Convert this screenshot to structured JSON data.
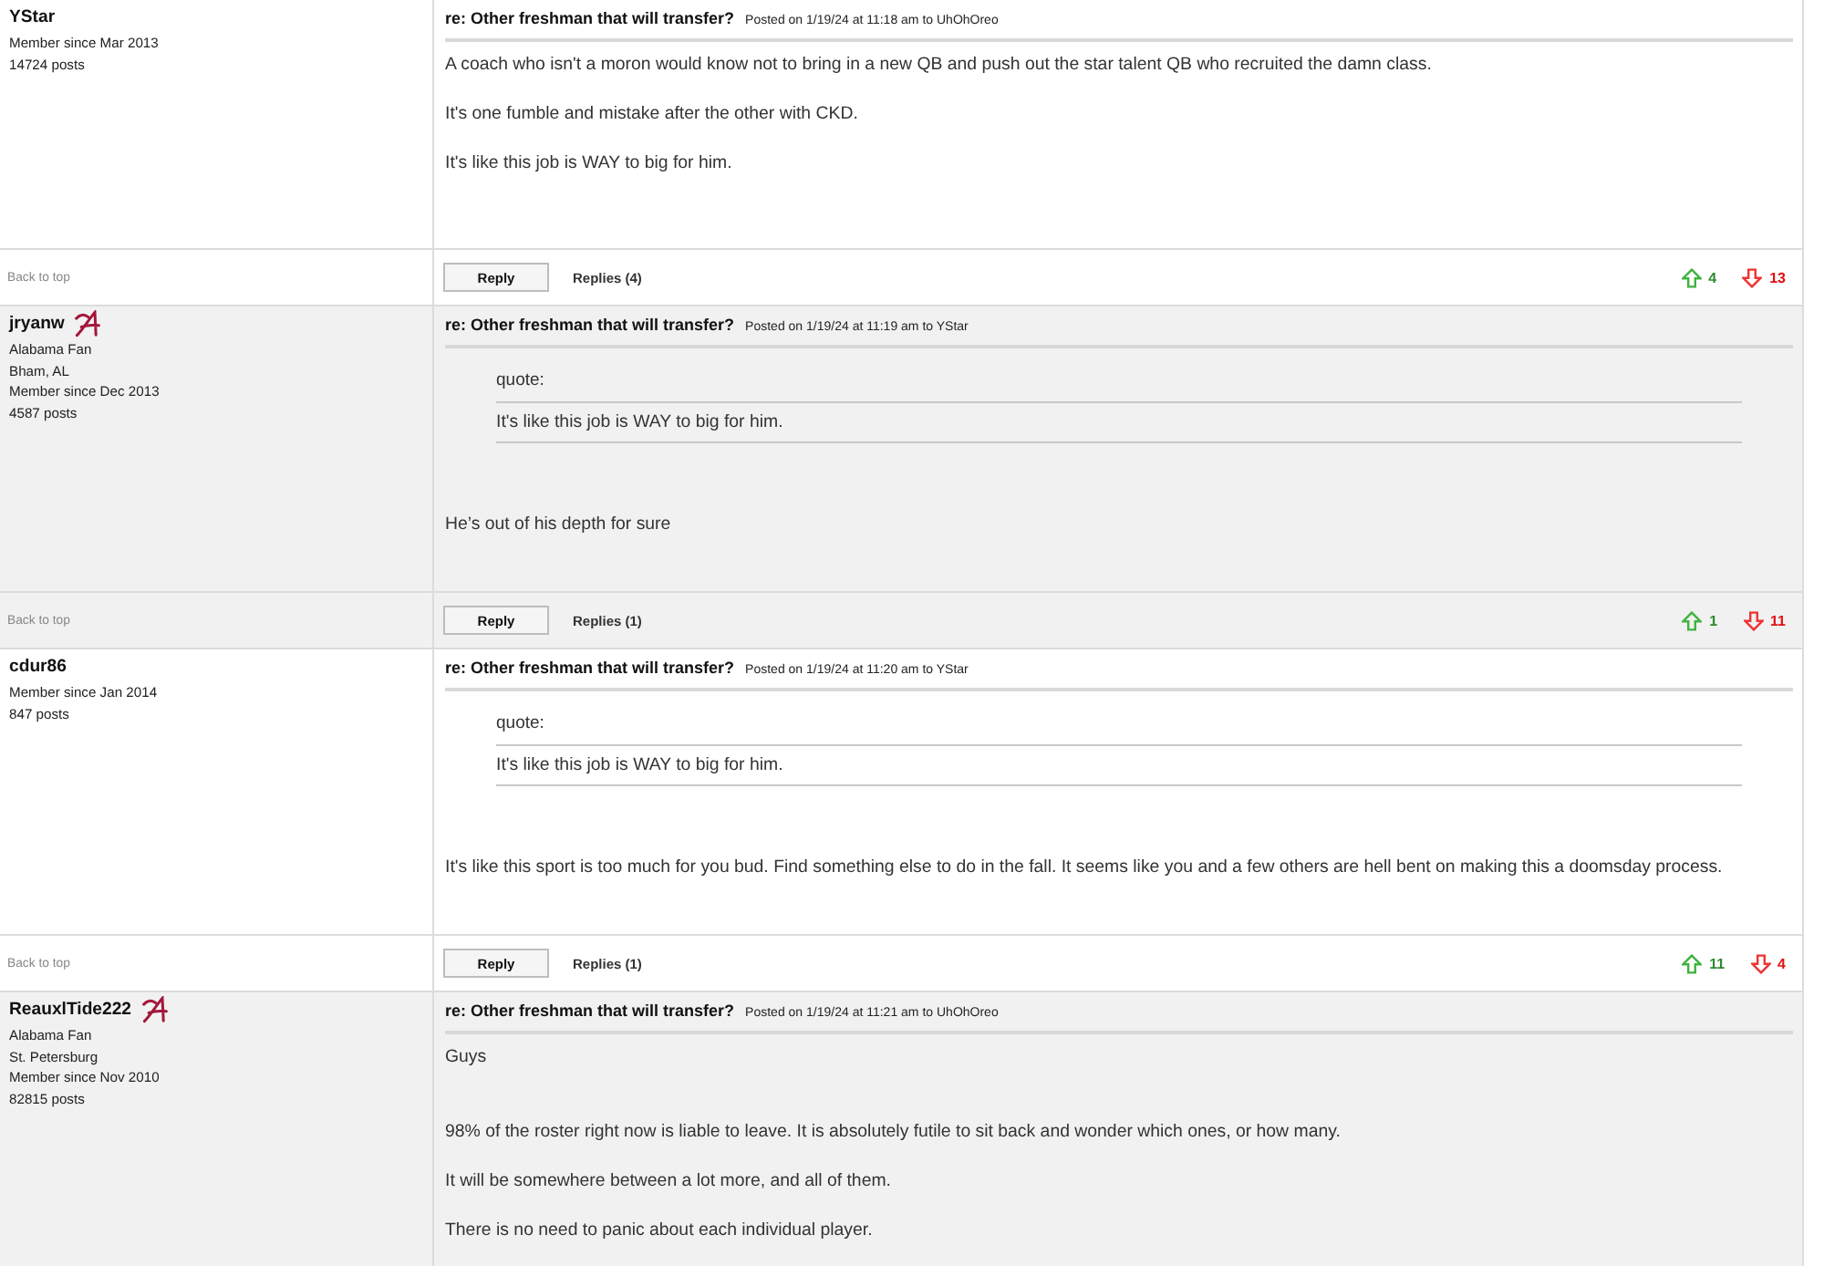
{
  "posts": [
    {
      "user": {
        "name": "YStar",
        "fan_badge": false,
        "details": [
          "Member since Mar 2013",
          "14724 posts"
        ]
      },
      "title": "re: Other freshman that will transfer?",
      "meta": "Posted on 1/19/24 at 11:18 am to UhOhOreo",
      "body": [
        {
          "kind": "text",
          "text": "A coach who isn't a moron would know not to bring in a new QB and push out the star talent QB who recruited the damn class."
        },
        {
          "kind": "text",
          "text": "It's one fumble and mistake after the other with CKD."
        },
        {
          "kind": "text",
          "text": "It's like this job is WAY to big for him."
        }
      ],
      "actions": {
        "back_to_top": "Back to top",
        "reply": "Reply",
        "replies": "Replies (4)",
        "upvotes": "4",
        "downvotes": "13"
      }
    },
    {
      "user": {
        "name": "jryanw",
        "fan_badge": true,
        "details": [
          "Alabama Fan",
          "Bham, AL",
          "Member since Dec 2013",
          "4587 posts"
        ]
      },
      "title": "re: Other freshman that will transfer?",
      "meta": "Posted on 1/19/24 at 11:19 am to YStar",
      "quote": {
        "label": "quote:",
        "text": "It's like this job is WAY to big for him."
      },
      "body": [
        {
          "kind": "text",
          "text": "He’s out of his depth for sure"
        }
      ],
      "actions": {
        "back_to_top": "Back to top",
        "reply": "Reply",
        "replies": "Replies (1)",
        "upvotes": "1",
        "downvotes": "11"
      }
    },
    {
      "user": {
        "name": "cdur86",
        "fan_badge": false,
        "details": [
          "Member since Jan 2014",
          "847 posts"
        ]
      },
      "title": "re: Other freshman that will transfer?",
      "meta": "Posted on 1/19/24 at 11:20 am to YStar",
      "quote": {
        "label": "quote:",
        "text": "It's like this job is WAY to big for him."
      },
      "body": [
        {
          "kind": "text",
          "text": "It's like this sport is too much for you bud. Find something else to do in the fall. It seems like you and a few others are hell bent on making this a doomsday process."
        }
      ],
      "actions": {
        "back_to_top": "Back to top",
        "reply": "Reply",
        "replies": "Replies (1)",
        "upvotes": "11",
        "downvotes": "4"
      }
    },
    {
      "user": {
        "name": "ReauxlTide222",
        "fan_badge": true,
        "details": [
          "Alabama Fan",
          "St. Petersburg",
          "Member since Nov 2010",
          "82815 posts"
        ]
      },
      "title": "re: Other freshman that will transfer?",
      "meta": "Posted on 1/19/24 at 11:21 am to UhOhOreo",
      "body": [
        {
          "kind": "text",
          "text": "Guys"
        },
        {
          "kind": "blank_line"
        },
        {
          "kind": "text",
          "text": "98% of the roster right now is liable to leave. It is absolutely futile to sit back and wonder which ones, or how many."
        },
        {
          "kind": "text",
          "text": "It will be somewhere between a lot more, and all of them."
        },
        {
          "kind": "text",
          "text": "There is no need to panic about each individual player."
        }
      ]
    }
  ]
}
